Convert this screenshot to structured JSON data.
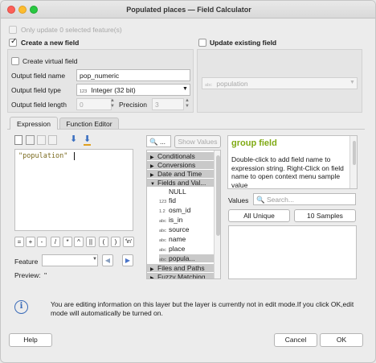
{
  "window": {
    "title": "Populated places — Field Calculator"
  },
  "top": {
    "only_update_label": "Only update 0 selected feature(s)"
  },
  "create": {
    "label": "Create a new field",
    "virtual_label": "Create virtual field",
    "name_label": "Output field name",
    "name_value": "pop_numeric",
    "type_label": "Output field type",
    "type_badge": "123",
    "type_value": "Integer (32 bit)",
    "length_label": "Output field length",
    "length_value": "0",
    "precision_label": "Precision",
    "precision_value": "3"
  },
  "update": {
    "label": "Update existing field",
    "field_badge": "abc",
    "field_value": "population"
  },
  "tabs": [
    {
      "label": "Expression"
    },
    {
      "label": "Function Editor"
    }
  ],
  "expression": {
    "text": "\"population\""
  },
  "operators": [
    "=",
    "+",
    "-",
    "/",
    "*",
    "^",
    "||",
    "(",
    ")",
    "'\\n'"
  ],
  "feature": {
    "label": "Feature",
    "preview_label": "Preview:",
    "preview_value": "''"
  },
  "search": {
    "placeholder": "",
    "show_values_label": "Show Values"
  },
  "tree": {
    "groups": [
      {
        "label": "Conditionals"
      },
      {
        "label": "Conversions"
      },
      {
        "label": "Date and Time"
      },
      {
        "label": "Fields and Val..."
      }
    ],
    "items": [
      {
        "badge": "",
        "label": "NULL"
      },
      {
        "badge": "123",
        "label": "fid"
      },
      {
        "badge": "1.2",
        "label": "osm_id"
      },
      {
        "badge": "abc",
        "label": "is_in"
      },
      {
        "badge": "abc",
        "label": "source"
      },
      {
        "badge": "abc",
        "label": "name"
      },
      {
        "badge": "abc",
        "label": "place"
      },
      {
        "badge": "abc",
        "label": "popula..."
      }
    ],
    "tail_groups": [
      {
        "label": "Files and Paths"
      },
      {
        "label": "Fuzzy Matching"
      }
    ]
  },
  "help_panel": {
    "title": "group field",
    "body": "Double-click to add field name to expression string. Right-Click on field name to open context menu sample value"
  },
  "values": {
    "label": "Values",
    "search_placeholder": "Search...",
    "all_unique_label": "All Unique",
    "samples_label": "10 Samples"
  },
  "info": {
    "message": "You are editing information on this layer but the layer is currently not in edit mode.If you click OK,edit mode will automatically be turned on."
  },
  "footer": {
    "help_label": "Help",
    "cancel_label": "Cancel",
    "ok_label": "OK"
  },
  "colors": {
    "accent": "#2f7de1",
    "help_title": "#7faa13",
    "close": "#fc5f57",
    "minimize": "#fdbc2e",
    "zoom": "#28c840"
  }
}
